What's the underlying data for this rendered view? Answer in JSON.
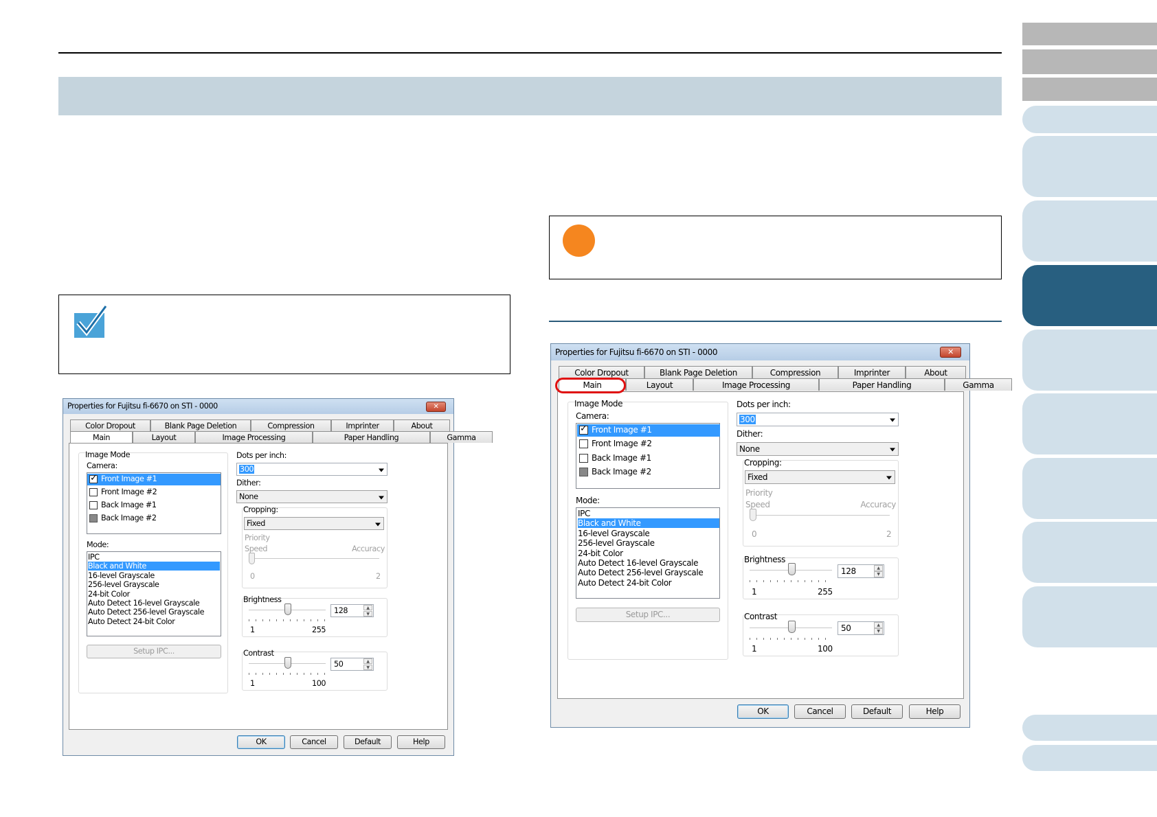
{
  "dialog": {
    "title": "Properties for Fujitsu fi-6670 on STI - 0000",
    "close_glyph": "✕",
    "tabs_back": [
      "Color Dropout",
      "Blank Page Deletion",
      "Compression",
      "Imprinter",
      "About"
    ],
    "tabs_front": [
      "Main",
      "Layout",
      "Image Processing",
      "Paper Handling",
      "Gamma"
    ],
    "image_mode_label": "Image Mode",
    "camera_label": "Camera:",
    "camera_items": [
      "Front Image #1",
      "Front Image #2",
      "Back Image #1",
      "Back Image #2"
    ],
    "mode_label": "Mode:",
    "mode_items": [
      "IPC",
      "Black and White",
      "16-level Grayscale",
      "256-level Grayscale",
      "24-bit Color",
      "Auto Detect 16-level Grayscale",
      "Auto Detect 256-level Grayscale",
      "Auto Detect 24-bit Color"
    ],
    "setup_ipc": "Setup IPC...",
    "dpi_label": "Dots per inch:",
    "dpi_value": "300",
    "dither_label": "Dither:",
    "dither_value": "None",
    "cropping_label": "Cropping:",
    "cropping_value": "Fixed",
    "priority_label": "Priority",
    "speed_label": "Speed",
    "accuracy_label": "Accuracy",
    "priority_min": "0",
    "priority_max": "2",
    "brightness_label": "Brightness",
    "brightness_value": "128",
    "brightness_min": "1",
    "brightness_max": "255",
    "contrast_label": "Contrast",
    "contrast_value": "50",
    "contrast_min": "1",
    "contrast_max": "100",
    "ok": "OK",
    "cancel": "Cancel",
    "default": "Default",
    "help": "Help"
  },
  "colors": {
    "title_band": "#c5d4dd",
    "side_tab_active": "#285f80",
    "side_tab_pale": "#d1e0ea",
    "side_tab_grey": "#b7b7b7",
    "attention_dot": "#f5861f",
    "highlight_ring": "#e01010"
  }
}
